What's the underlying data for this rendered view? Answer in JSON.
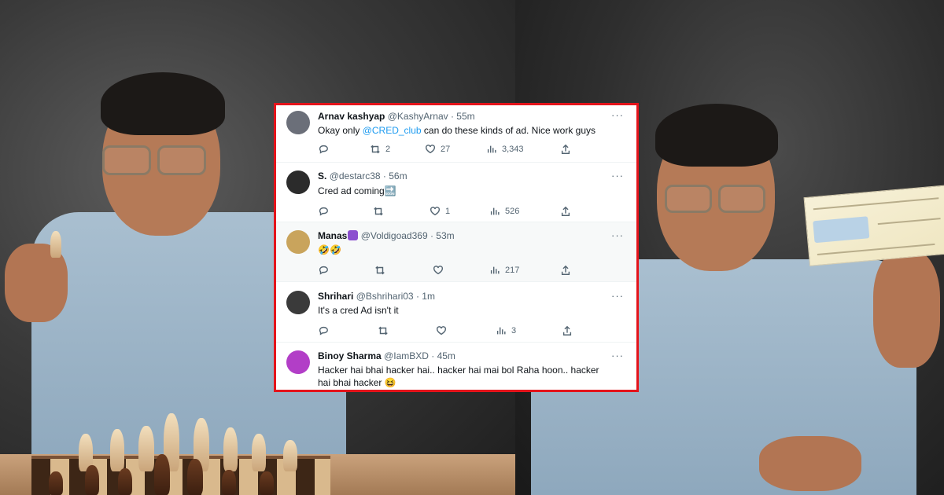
{
  "tweets": [
    {
      "name": "Arnav kashyap",
      "handle": "@KashyArnav",
      "time": "· 55m",
      "text_before": "Okay only ",
      "mention": "@CRED_club",
      "text_after": " can do these kinds of ad. Nice work guys",
      "replies": "",
      "retweets": "2",
      "likes": "27",
      "views": "3,343",
      "avatar_color": "#6b6f79"
    },
    {
      "name": "S.",
      "handle": "@destarc38",
      "time": "· 56m",
      "text": "Cred ad coming🔜",
      "replies": "",
      "retweets": "",
      "likes": "1",
      "views": "526",
      "avatar_color": "#2b2b2b"
    },
    {
      "name": "Manas",
      "handle": "@Voldigoad369",
      "time": "· 53m",
      "text": "🤣🤣",
      "replies": "",
      "retweets": "",
      "likes": "",
      "views": "217",
      "avatar_color": "#c9a45c"
    },
    {
      "name": "Shrihari",
      "handle": "@Bshrihari03",
      "time": "· 1m",
      "text": "It's a cred Ad isn't it",
      "replies": "",
      "retweets": "",
      "likes": "",
      "views": "3",
      "avatar_color": "#3a3a3a"
    },
    {
      "name": "Binoy Sharma",
      "handle": "@IamBXD",
      "time": "· 45m",
      "text": "Hacker hai bhai hacker hai.. hacker hai mai bol Raha hoon.. hacker hai bhai hacker 😆",
      "avatar_color": "#b23ec7"
    }
  ],
  "colors": {
    "frame": "#e4141b",
    "mention": "#1d9bf0",
    "muted": "#536471"
  },
  "icons": [
    "reply-icon",
    "retweet-icon",
    "like-icon",
    "views-icon",
    "share-icon",
    "more-icon"
  ],
  "more_label": "···"
}
